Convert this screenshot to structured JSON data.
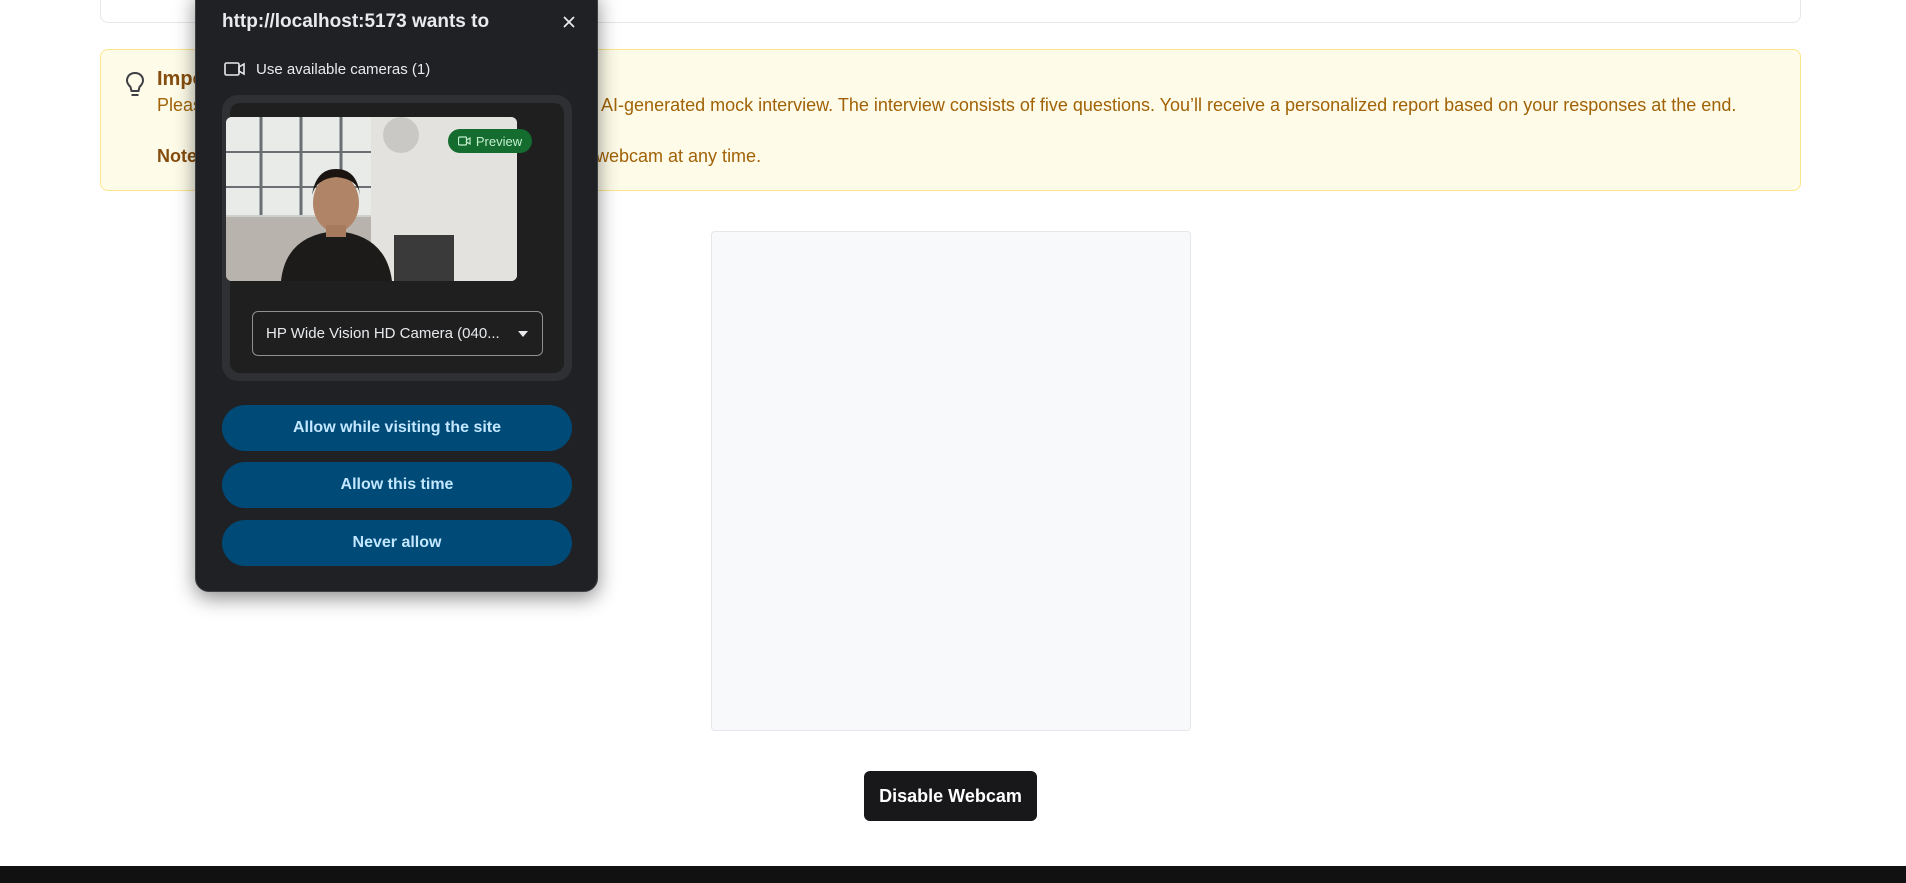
{
  "banner": {
    "title": "Impo",
    "line1": "Pleas",
    "line1_visible_tail": "AI-generated mock interview. The interview consists of five questions. You’ll receive a personalized report based on your responses at the end.",
    "note_label": "Note",
    "line2_visible_tail": "webcam at any time."
  },
  "webcam": {
    "disable_label": "Disable Webcam"
  },
  "popup": {
    "title": "http://localhost:5173 wants to",
    "camera_row_label": "Use available cameras (1)",
    "preview_badge": "Preview",
    "selected_camera": "HP Wide Vision HD Camera (040...",
    "allow_site_label": "Allow while visiting the site",
    "allow_once_label": "Allow this time",
    "never_label": "Never allow"
  },
  "colors": {
    "banner_bg": "#fefce8",
    "banner_text": "#a16207",
    "popup_bg": "#202124",
    "popup_button": "#004a77",
    "preview_badge": "#146c2e"
  }
}
